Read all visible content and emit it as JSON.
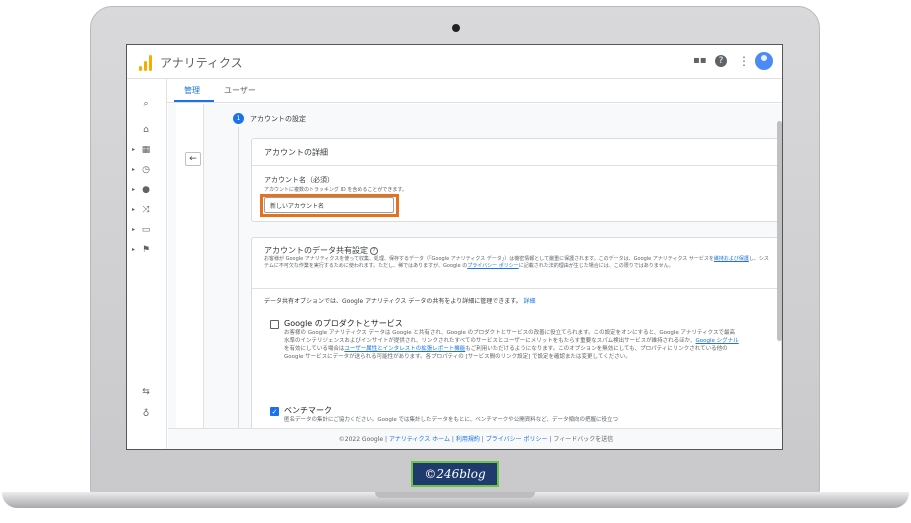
{
  "app": {
    "title": "アナリティクス"
  },
  "header": {
    "apps_icon": "apps-grid-icon",
    "help_icon": "help-icon",
    "more_icon": "more-vert-icon",
    "avatar": "account-avatar"
  },
  "tabs": [
    {
      "label": "管理",
      "active": true
    },
    {
      "label": "ユーザー",
      "active": false
    }
  ],
  "rail": [
    "search-icon",
    "home-icon",
    "dashboard-icon",
    "realtime-icon",
    "audience-icon",
    "acquisition-icon",
    "behavior-icon",
    "conversions-icon",
    "attribution-icon",
    "discover-icon",
    "settings-icon"
  ],
  "step": {
    "number": "1",
    "title": "アカウントの設定"
  },
  "account_details": {
    "title": "アカウントの詳細",
    "field_label": "アカウント名（必須）",
    "field_help": "アカウントに複数のトラッキング ID を含めることができます。",
    "field_value": "新しいアカウント名"
  },
  "data_sharing": {
    "title": "アカウントのデータ共有設定",
    "desc_1": "お客様が Google アナリティクスを使って収集、処理、保存するデータ（「Google アナリティクス データ」）は機密情報として厳重に保護されます。このデータは、Google アナリティクス サービスを",
    "desc_link_1": "維持および保護",
    "desc_2": "し、システムに不可欠な作業を実行するために使われます。ただし、稀ではありますが、Google の",
    "desc_link_2": "プライバシー ポリシー",
    "desc_3": "に記載された法的理由が生じた場合には、この限りではありません。",
    "intro": "データ共有オプションでは、Google アナリティクス データの共有をより詳細に管理できます。",
    "intro_link": "詳細",
    "options": [
      {
        "title": "Google のプロダクトとサービス",
        "checked": false,
        "desc_1": "お客様の Google アナリティクス データは Google と共有され、Google のプロダクトとサービスの改善に役立てられます。この設定をオンにすると、Google アナリティクスで最高水準のインテリジェンスおよびインサイトが提供され、リンクされたすべてのサービスとユーザーにメリットをもたらす重要なスパム検出サービスが維持されるほか、",
        "link_1": "Google シグナル",
        "desc_2": "を有効にしている場合は",
        "link_2": "ユーザー属性とインタレストの拡張レポート機能",
        "desc_3": "もご利用いただけるようになります。このオプションを無効にしても、プロパティにリンクされている他の Google サービスにデータが送られる可能性があります。各プロパティの [サービス間のリンク設定] で設定を確認または変更してください。"
      },
      {
        "title": "ベンチマーク",
        "checked": true,
        "desc_1": "匿名データの集計にご協力ください。Google では集計したデータをもとに、ベンチマークや公開資料など、データ傾向の把握に役立つ"
      }
    ]
  },
  "footer": {
    "copyright": "©2022 Google",
    "links": [
      "アナリティクス ホーム",
      "利用規約",
      "プライバシー ポリシー"
    ],
    "feedback": "フィードバックを送信"
  },
  "watermark": "©246blog",
  "colors": {
    "accent": "#1a73e8",
    "logo": "#f9ab00",
    "highlight": "#e8711c",
    "watermark_bg": "#1f3b6e",
    "watermark_border": "#69c24a"
  }
}
